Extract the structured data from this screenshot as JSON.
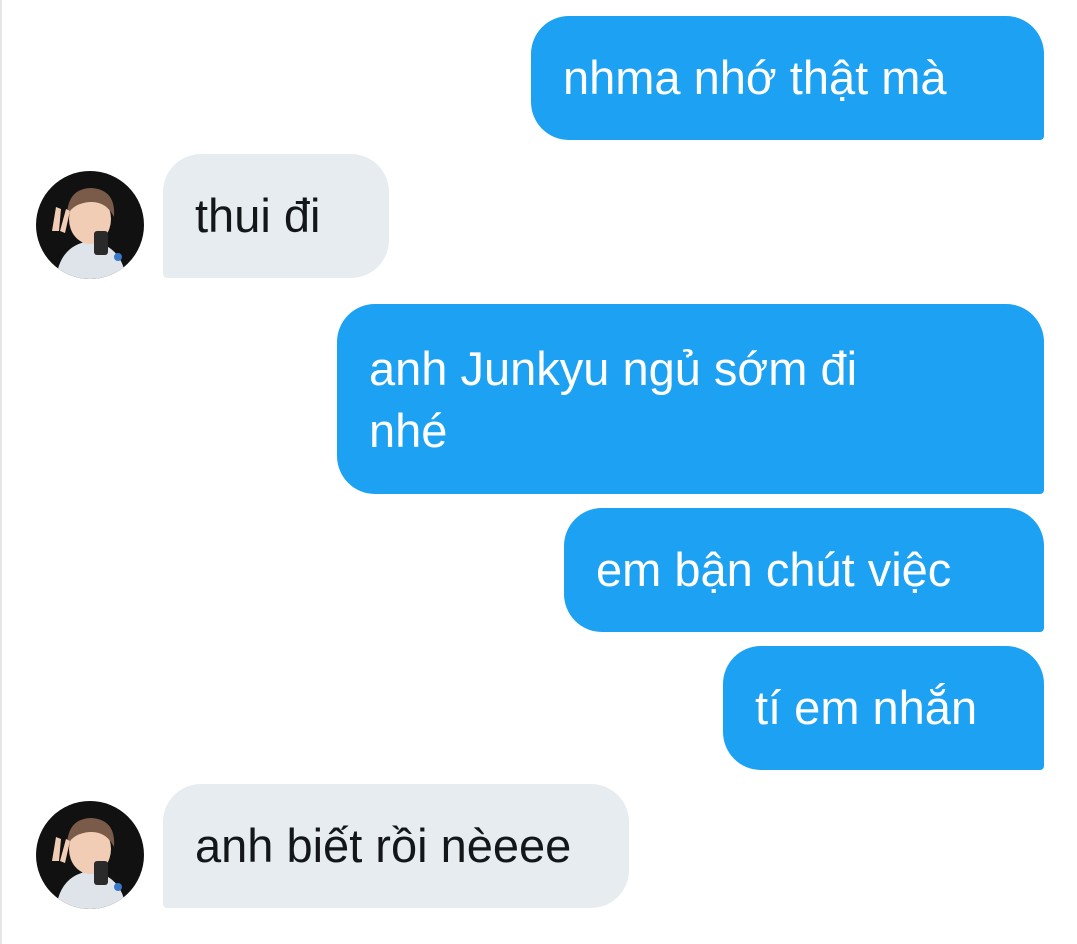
{
  "conversation": {
    "messages": [
      {
        "sender": "me",
        "text": "nhma nhớ thật mà"
      },
      {
        "sender": "other",
        "text": "thui đi"
      },
      {
        "sender": "me",
        "text": "anh Junkyu ngủ sớm đi\nnhé"
      },
      {
        "sender": "me",
        "text": "em bận chút việc"
      },
      {
        "sender": "me",
        "text": "tí em nhắn"
      },
      {
        "sender": "other",
        "text": "anh biết rồi nèeee"
      }
    ],
    "colors": {
      "sent_bubble": "#1da1f2",
      "sent_text": "#ffffff",
      "received_bubble": "#e6ecf0",
      "received_text": "#14171a"
    },
    "icons": {
      "avatar": "user-avatar-photo"
    }
  }
}
